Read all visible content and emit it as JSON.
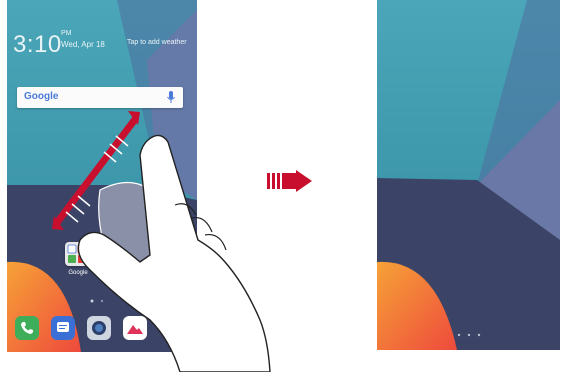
{
  "left_screen": {
    "clock": "3:10",
    "ampm": "PM",
    "date": "Wed, Apr 18",
    "weather_hint": "Tap to add weather",
    "search": {
      "logo_text": "Google",
      "icon": "mic-icon"
    },
    "folder": {
      "label": "Google"
    },
    "dock": [
      "phone-icon",
      "messages-icon",
      "camera-icon",
      "gallery-icon"
    ]
  },
  "gesture": {
    "type": "pinch-out",
    "icons": [
      "hand-icon",
      "double-arrow-icon"
    ]
  },
  "transition": {
    "icon": "arrow-right-icon"
  },
  "right_screen": {
    "page_indicator_dots": 3
  },
  "colors": {
    "sky": "#3e9eb0",
    "ground": "#3c4468",
    "triangle": "#6a78a8",
    "orange": "#f0603a",
    "arrow": "#c8102e"
  }
}
